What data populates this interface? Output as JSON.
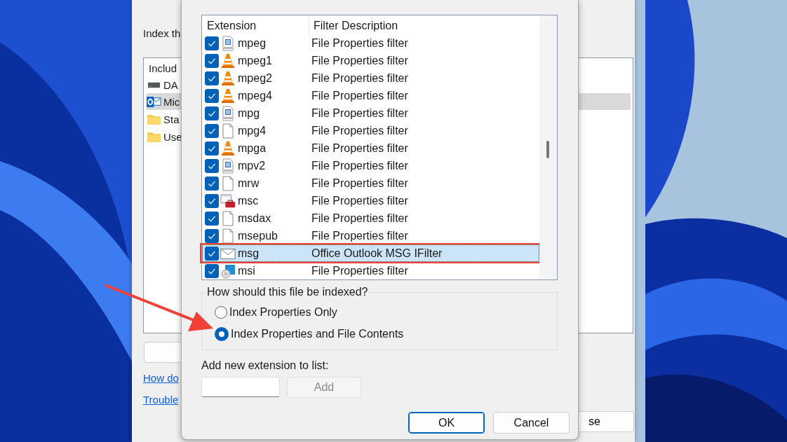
{
  "back_window": {
    "heading": "Index th",
    "list_header": "Includ",
    "items": [
      {
        "label": "DA",
        "kind": "drive",
        "selected": false
      },
      {
        "label": "Mic",
        "kind": "mailapp",
        "selected": true
      },
      {
        "label": "Sta",
        "kind": "folder",
        "selected": false
      },
      {
        "label": "Use",
        "kind": "folder",
        "selected": false
      }
    ],
    "links": [
      "How do",
      "Trouble"
    ],
    "close_button": "se"
  },
  "dialog": {
    "columns": [
      "Extension",
      "Filter Description"
    ],
    "rows": [
      {
        "ext": "mpeg",
        "kind": "video",
        "desc": "File Properties filter",
        "checked": true,
        "selected": false,
        "annotated": false
      },
      {
        "ext": "mpeg1",
        "kind": "cone",
        "desc": "File Properties filter",
        "checked": true,
        "selected": false,
        "annotated": false
      },
      {
        "ext": "mpeg2",
        "kind": "cone",
        "desc": "File Properties filter",
        "checked": true,
        "selected": false,
        "annotated": false
      },
      {
        "ext": "mpeg4",
        "kind": "cone",
        "desc": "File Properties filter",
        "checked": true,
        "selected": false,
        "annotated": false
      },
      {
        "ext": "mpg",
        "kind": "video",
        "desc": "File Properties filter",
        "checked": true,
        "selected": false,
        "annotated": false
      },
      {
        "ext": "mpg4",
        "kind": "blank",
        "desc": "File Properties filter",
        "checked": true,
        "selected": false,
        "annotated": false
      },
      {
        "ext": "mpga",
        "kind": "cone",
        "desc": "File Properties filter",
        "checked": true,
        "selected": false,
        "annotated": false
      },
      {
        "ext": "mpv2",
        "kind": "video",
        "desc": "File Properties filter",
        "checked": true,
        "selected": false,
        "annotated": false
      },
      {
        "ext": "mrw",
        "kind": "blank",
        "desc": "File Properties filter",
        "checked": true,
        "selected": false,
        "annotated": false
      },
      {
        "ext": "msc",
        "kind": "toolbox",
        "desc": "File Properties filter",
        "checked": true,
        "selected": false,
        "annotated": false
      },
      {
        "ext": "msdax",
        "kind": "blank",
        "desc": "File Properties filter",
        "checked": true,
        "selected": false,
        "annotated": false
      },
      {
        "ext": "msepub",
        "kind": "blank",
        "desc": "File Properties filter",
        "checked": true,
        "selected": false,
        "annotated": false
      },
      {
        "ext": "msg",
        "kind": "mail",
        "desc": "Office Outlook MSG IFilter",
        "checked": true,
        "selected": true,
        "annotated": true
      },
      {
        "ext": "msi",
        "kind": "installer",
        "desc": "File Properties filter",
        "checked": true,
        "selected": false,
        "annotated": false
      }
    ],
    "group": {
      "legend": "How should this file be indexed?",
      "options": [
        {
          "label": "Index Properties Only",
          "selected": false
        },
        {
          "label": "Index Properties and File Contents",
          "selected": true
        }
      ]
    },
    "add_label": "Add new extension to list:",
    "add_button": {
      "label": "Add",
      "disabled": true
    },
    "buttons": [
      {
        "label": "OK",
        "default": true
      },
      {
        "label": "Cancel",
        "default": false
      }
    ]
  }
}
